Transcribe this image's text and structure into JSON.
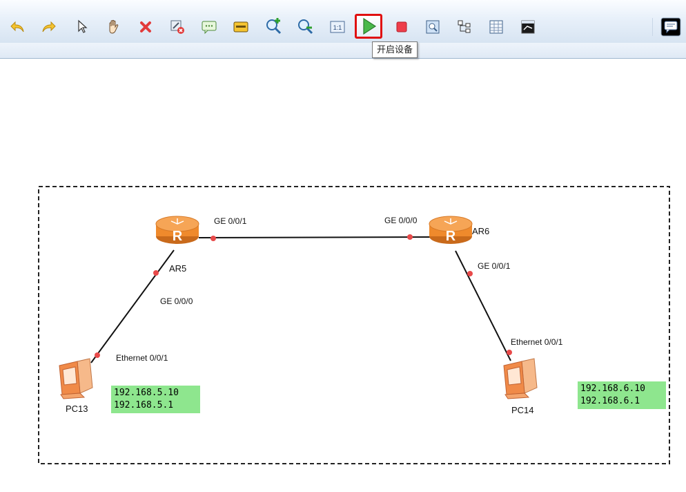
{
  "toolbar": {
    "buttons": [
      {
        "name": "undo",
        "icon": "undo-icon"
      },
      {
        "name": "redo",
        "icon": "redo-icon"
      },
      {
        "name": "select",
        "icon": "cursor-icon"
      },
      {
        "name": "pan",
        "icon": "hand-icon"
      },
      {
        "name": "delete",
        "icon": "delete-icon"
      },
      {
        "name": "delete-link",
        "icon": "delete-link-icon"
      },
      {
        "name": "text",
        "icon": "text-box-icon"
      },
      {
        "name": "shape",
        "icon": "rectangle-icon"
      },
      {
        "name": "zoom-in",
        "icon": "zoom-in-icon"
      },
      {
        "name": "zoom-out",
        "icon": "zoom-out-icon"
      },
      {
        "name": "fit",
        "icon": "fit-1-1-icon"
      },
      {
        "name": "start-devices",
        "icon": "play-icon"
      },
      {
        "name": "stop-devices",
        "icon": "stop-icon"
      },
      {
        "name": "capture",
        "icon": "capture-icon"
      },
      {
        "name": "topology",
        "icon": "topology-icon"
      },
      {
        "name": "grid",
        "icon": "grid-icon"
      },
      {
        "name": "console",
        "icon": "console-icon"
      }
    ],
    "tooltip": "开启设备",
    "chat_icon": "chat-icon"
  },
  "topology": {
    "devices": [
      {
        "name": "AR5",
        "type": "router"
      },
      {
        "name": "AR6",
        "type": "router"
      },
      {
        "name": "PC13",
        "type": "pc"
      },
      {
        "name": "PC14",
        "type": "pc"
      }
    ],
    "links": [
      {
        "from": "AR5",
        "from_port": "GE 0/0/1",
        "to": "AR6",
        "to_port": "GE 0/0/0"
      },
      {
        "from": "AR5",
        "from_port": "GE 0/0/0",
        "to": "PC13",
        "to_port": "Ethernet 0/0/1"
      },
      {
        "from": "AR6",
        "from_port": "GE 0/0/1",
        "to": "PC14",
        "to_port": "Ethernet 0/0/1"
      }
    ],
    "labels": {
      "ar5_ge001": "GE 0/0/1",
      "ar6_ge000": "GE 0/0/0",
      "ar5_ge000": "GE 0/0/0",
      "ar6_ge001": "GE 0/0/1",
      "pc13_eth": "Ethernet 0/0/1",
      "pc14_eth": "Ethernet 0/0/1"
    },
    "pc13_ip": {
      "address": "192.168.5.10",
      "gateway": "192.168.5.1"
    },
    "pc14_ip": {
      "address": "192.168.6.10",
      "gateway": "192.168.6.1"
    }
  },
  "colors": {
    "ip_box": "#8ee68e",
    "port_dot": "#e84a4a",
    "router_orange": "#f08a2c",
    "highlight_red": "#e01010"
  }
}
